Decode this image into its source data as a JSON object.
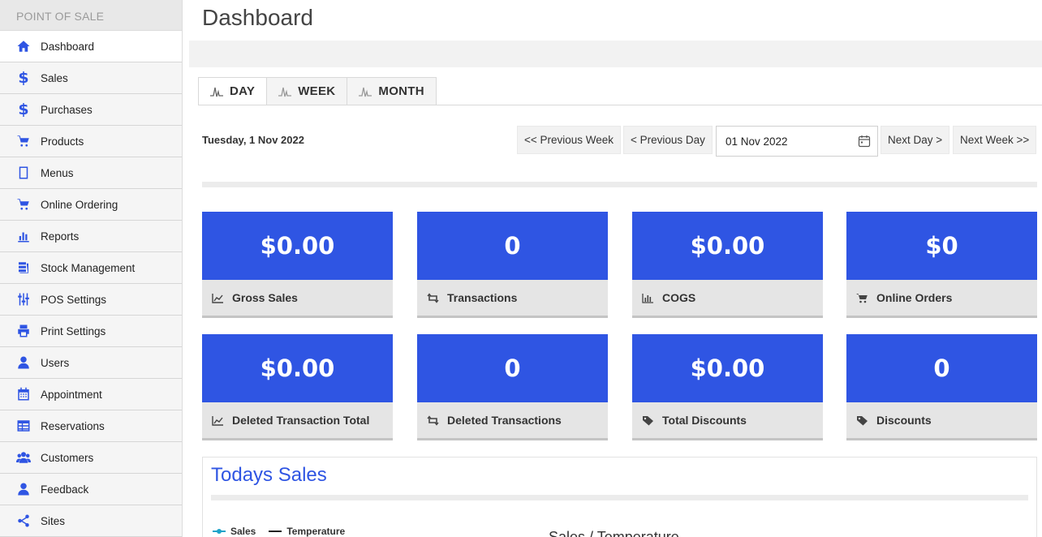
{
  "sidebar": {
    "header": "POINT OF SALE",
    "items": [
      {
        "label": "Dashboard",
        "icon": "home-icon"
      },
      {
        "label": "Sales",
        "icon": "dollar-icon"
      },
      {
        "label": "Purchases",
        "icon": "dollar-icon"
      },
      {
        "label": "Products",
        "icon": "cart-icon"
      },
      {
        "label": "Menus",
        "icon": "tablet-icon"
      },
      {
        "label": "Online Ordering",
        "icon": "cart-icon"
      },
      {
        "label": "Reports",
        "icon": "bar-chart-icon"
      },
      {
        "label": "Stock Management",
        "icon": "stock-icon"
      },
      {
        "label": "POS Settings",
        "icon": "sliders-icon"
      },
      {
        "label": "Print Settings",
        "icon": "printer-icon"
      },
      {
        "label": "Users",
        "icon": "user-icon"
      },
      {
        "label": "Appointment",
        "icon": "calendar-icon"
      },
      {
        "label": "Reservations",
        "icon": "table-icon"
      },
      {
        "label": "Customers",
        "icon": "users-icon"
      },
      {
        "label": "Feedback",
        "icon": "user-icon"
      },
      {
        "label": "Sites",
        "icon": "share-icon"
      }
    ]
  },
  "main": {
    "title": "Dashboard",
    "tabs": [
      {
        "label": "DAY"
      },
      {
        "label": "WEEK"
      },
      {
        "label": "MONTH"
      }
    ],
    "date_label": "Tuesday, 1 Nov 2022",
    "buttons": {
      "prev_week": "<< Previous Week",
      "prev_day": "< Previous Day",
      "next_day": "Next Day >",
      "next_week": "Next Week >>"
    },
    "date_input": "01 Nov 2022",
    "cards": [
      {
        "value": "$0.00",
        "label": "Gross Sales",
        "icon": "line-chart-icon"
      },
      {
        "value": "0",
        "label": "Transactions",
        "icon": "retweet-icon"
      },
      {
        "value": "$0.00",
        "label": "COGS",
        "icon": "bar-chart-icon"
      },
      {
        "value": "$0",
        "label": "Online Orders",
        "icon": "cart-icon"
      },
      {
        "value": "$0.00",
        "label": "Deleted Transaction Total",
        "icon": "line-chart-icon"
      },
      {
        "value": "0",
        "label": "Deleted Transactions",
        "icon": "retweet-icon"
      },
      {
        "value": "$0.00",
        "label": "Total Discounts",
        "icon": "tag-icon"
      },
      {
        "value": "0",
        "label": "Discounts",
        "icon": "tag-icon"
      }
    ],
    "sales_panel": {
      "title": "Todays Sales",
      "legend": [
        {
          "label": "Sales",
          "color": "#1fa3c9"
        },
        {
          "label": "Temperature",
          "color": "#222222"
        }
      ],
      "chart_title": "Sales / Temperature"
    },
    "accent_color": "#2f55e3"
  }
}
